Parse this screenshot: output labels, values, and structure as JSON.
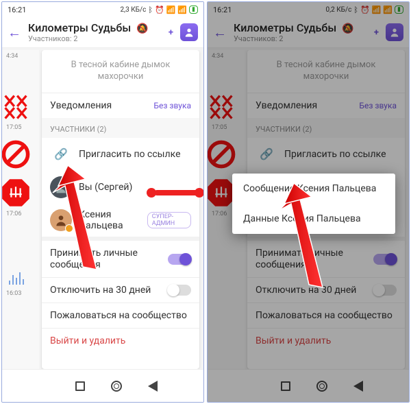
{
  "status": {
    "time": "16:21",
    "speed_left": "2,3 КБ/с",
    "speed_right": "0,2 КБ/с"
  },
  "header": {
    "title": "Километры Судьбы",
    "subtitle": "Участников: 2"
  },
  "panel": {
    "description": "В тесной кабине дымок махорочки",
    "notifications": "Уведомления",
    "mute_status": "Без звука",
    "participants_head": "УЧАСТНИКИ (2)",
    "invite": "Пригласить по ссылке",
    "you": "Вы (Сергей)",
    "member": "Ксения Пальцева",
    "member_badge": "СУПЕР-АДМИН",
    "private_msg": "Принимать личные сообщения",
    "disable30": "Отключить на 30 дней",
    "report": "Пожаловаться на сообщество",
    "leave": "Выйти и удалить"
  },
  "popup": {
    "message": "Сообщение Ксения Пальцева",
    "data": "Данные Ксения Пальцева"
  },
  "timestamps": {
    "t1": "4:34",
    "t2": "17:05",
    "t3": "17:06",
    "t4": "16:03"
  }
}
